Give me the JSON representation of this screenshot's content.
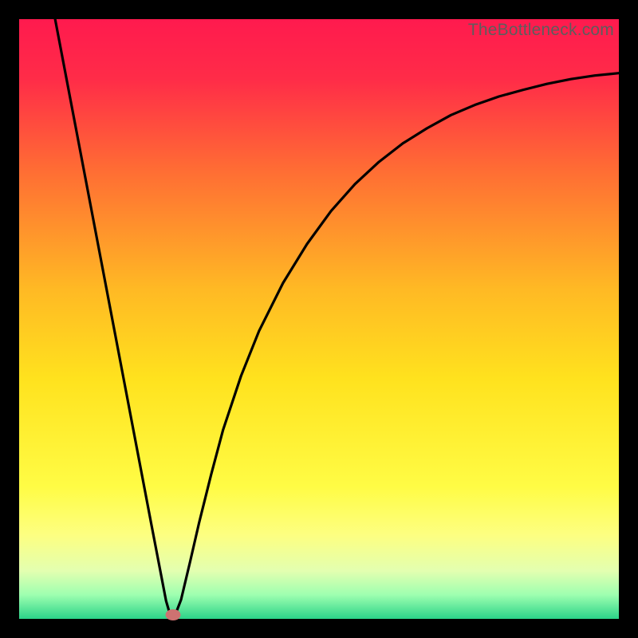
{
  "watermark": "TheBottleneck.com",
  "chart_data": {
    "type": "line",
    "title": "",
    "xlabel": "",
    "ylabel": "",
    "xlim": [
      0,
      100
    ],
    "ylim": [
      0,
      100
    ],
    "background_gradient": {
      "stops": [
        {
          "pct": 0,
          "color": "#ff1a4e"
        },
        {
          "pct": 10,
          "color": "#ff2c48"
        },
        {
          "pct": 25,
          "color": "#ff6c34"
        },
        {
          "pct": 45,
          "color": "#ffb924"
        },
        {
          "pct": 60,
          "color": "#ffe21e"
        },
        {
          "pct": 78,
          "color": "#fffc45"
        },
        {
          "pct": 86,
          "color": "#fdff81"
        },
        {
          "pct": 92,
          "color": "#e3ffb0"
        },
        {
          "pct": 96,
          "color": "#9effb0"
        },
        {
          "pct": 100,
          "color": "#2bd389"
        }
      ]
    },
    "series": [
      {
        "name": "bottleneck-curve",
        "color": "#000000",
        "points": [
          {
            "x": 6.0,
            "y": 100.0
          },
          {
            "x": 8.0,
            "y": 89.5
          },
          {
            "x": 10.0,
            "y": 79.0
          },
          {
            "x": 12.0,
            "y": 68.5
          },
          {
            "x": 14.0,
            "y": 58.0
          },
          {
            "x": 16.0,
            "y": 47.5
          },
          {
            "x": 18.0,
            "y": 37.0
          },
          {
            "x": 20.0,
            "y": 26.5
          },
          {
            "x": 22.0,
            "y": 16.0
          },
          {
            "x": 23.5,
            "y": 8.2
          },
          {
            "x": 24.5,
            "y": 3.0
          },
          {
            "x": 25.2,
            "y": 0.6
          },
          {
            "x": 26.0,
            "y": 0.6
          },
          {
            "x": 27.0,
            "y": 3.2
          },
          {
            "x": 28.5,
            "y": 9.5
          },
          {
            "x": 30.0,
            "y": 16.0
          },
          {
            "x": 32.0,
            "y": 24.0
          },
          {
            "x": 34.0,
            "y": 31.5
          },
          {
            "x": 37.0,
            "y": 40.5
          },
          {
            "x": 40.0,
            "y": 48.0
          },
          {
            "x": 44.0,
            "y": 56.0
          },
          {
            "x": 48.0,
            "y": 62.5
          },
          {
            "x": 52.0,
            "y": 68.0
          },
          {
            "x": 56.0,
            "y": 72.5
          },
          {
            "x": 60.0,
            "y": 76.2
          },
          {
            "x": 64.0,
            "y": 79.3
          },
          {
            "x": 68.0,
            "y": 81.8
          },
          {
            "x": 72.0,
            "y": 84.0
          },
          {
            "x": 76.0,
            "y": 85.7
          },
          {
            "x": 80.0,
            "y": 87.1
          },
          {
            "x": 84.0,
            "y": 88.2
          },
          {
            "x": 88.0,
            "y": 89.2
          },
          {
            "x": 92.0,
            "y": 90.0
          },
          {
            "x": 96.0,
            "y": 90.6
          },
          {
            "x": 100.0,
            "y": 91.0
          }
        ]
      }
    ],
    "marker": {
      "x": 25.6,
      "y": 0.6,
      "color": "#cd7271"
    }
  }
}
